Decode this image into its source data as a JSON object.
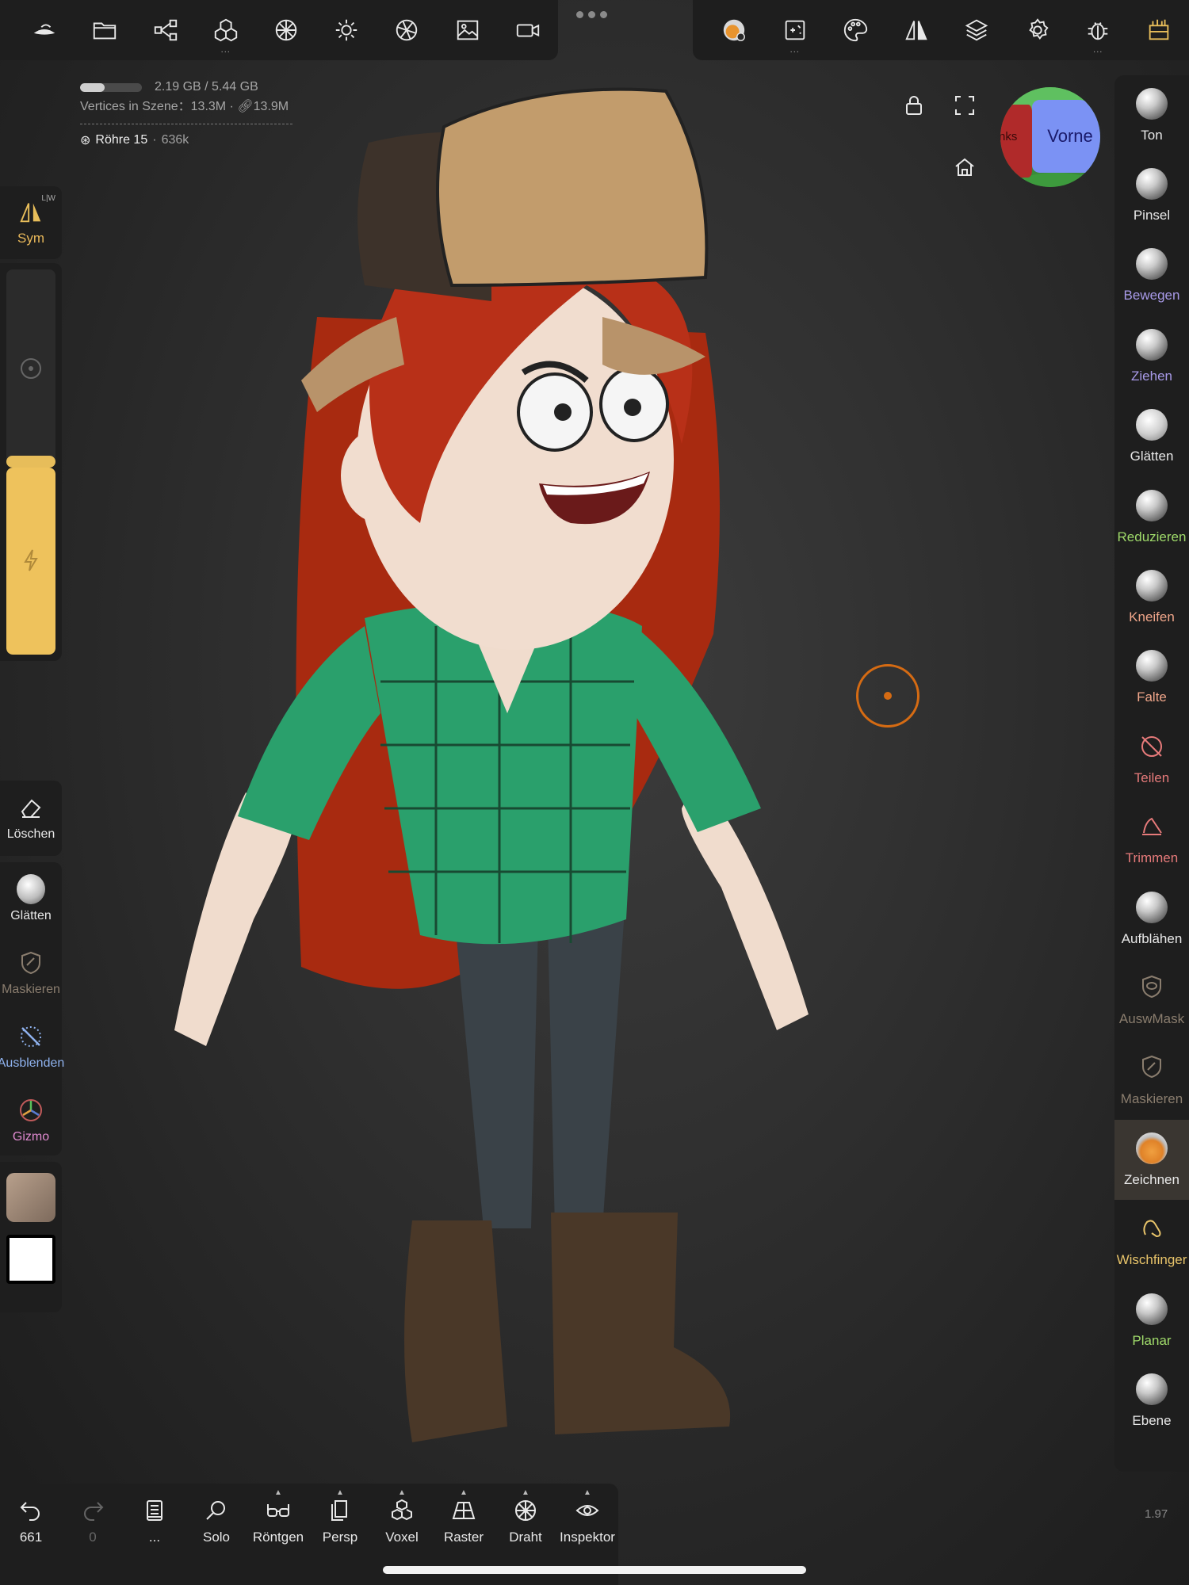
{
  "top_bar": {
    "left_icons": [
      "nomad-logo-icon",
      "folder-icon",
      "scene-graph-icon",
      "mesh-icon",
      "topology-icon",
      "lighting-icon",
      "shading-icon",
      "background-image-icon",
      "camera-icon"
    ],
    "right_icons": [
      "material-icon",
      "painting-icon",
      "palette-icon",
      "symmetry-icon",
      "layers-icon",
      "settings-icon",
      "debug-icon",
      "tools-box-icon"
    ]
  },
  "stats": {
    "memory": "2.19 GB / 5.44 GB",
    "memory_fraction": 0.4,
    "vertices_label": "Vertices in Szene：",
    "vertices_count": "13.3M",
    "vertices_link": "13.9M",
    "object_name": "Röhre 15",
    "object_verts": "636k"
  },
  "view_cube": {
    "front_label": "Vorne",
    "left_label": "nks"
  },
  "left_panel": {
    "sym": {
      "label": "Sym",
      "tag": "L|W"
    },
    "radius_fraction": 0.06,
    "intensity_fraction": 1.0,
    "erase": {
      "label": "Löschen"
    },
    "quick": [
      {
        "label": "Glätten",
        "color": "#e8e8e8"
      },
      {
        "label": "Maskieren",
        "color": "#8a7d6e"
      },
      {
        "label": "Ausblenden",
        "color": "#8fb2ee"
      },
      {
        "label": "Gizmo",
        "color": "#e08ad0"
      }
    ]
  },
  "tools": [
    {
      "label": "Ton",
      "color": "#e8e8e8"
    },
    {
      "label": "Pinsel",
      "color": "#e8e8e8"
    },
    {
      "label": "Bewegen",
      "color": "#a89ae8"
    },
    {
      "label": "Ziehen",
      "color": "#a89ae8"
    },
    {
      "label": "Glätten",
      "color": "#e8e8e8"
    },
    {
      "label": "Reduzieren",
      "color": "#9fda6a"
    },
    {
      "label": "Kneifen",
      "color": "#f0a68a"
    },
    {
      "label": "Falte",
      "color": "#f0a68a"
    },
    {
      "label": "Teilen",
      "color": "#e67a7a"
    },
    {
      "label": "Trimmen",
      "color": "#e67a7a"
    },
    {
      "label": "Aufblähen",
      "color": "#e8e8e8"
    },
    {
      "label": "AuswMask",
      "color": "#8a7d6e"
    },
    {
      "label": "Maskieren",
      "color": "#8a7d6e"
    },
    {
      "label": "Zeichnen",
      "color": "#e8e8e8"
    },
    {
      "label": "Wischfinger",
      "color": "#e8c46a"
    },
    {
      "label": "Planar",
      "color": "#9fda6a"
    },
    {
      "label": "Ebene",
      "color": "#e8e8e8"
    }
  ],
  "bottom_bar": [
    {
      "label": "661",
      "icon": "undo-icon"
    },
    {
      "label": "0",
      "icon": "redo-icon"
    },
    {
      "label": "...",
      "icon": "notes-icon"
    },
    {
      "label": "Solo",
      "icon": "search-icon"
    },
    {
      "label": "Röntgen",
      "icon": "glasses-icon"
    },
    {
      "label": "Persp",
      "icon": "persp-icon"
    },
    {
      "label": "Voxel",
      "icon": "voxel-icon"
    },
    {
      "label": "Raster",
      "icon": "grid-icon"
    },
    {
      "label": "Draht",
      "icon": "wireframe-icon"
    },
    {
      "label": "Inspektor",
      "icon": "eye-icon"
    }
  ],
  "version": "1.97",
  "colors": {
    "accent": "#e7bd5a",
    "cursor": "#d56b13",
    "panel": "#1e1e1e"
  }
}
